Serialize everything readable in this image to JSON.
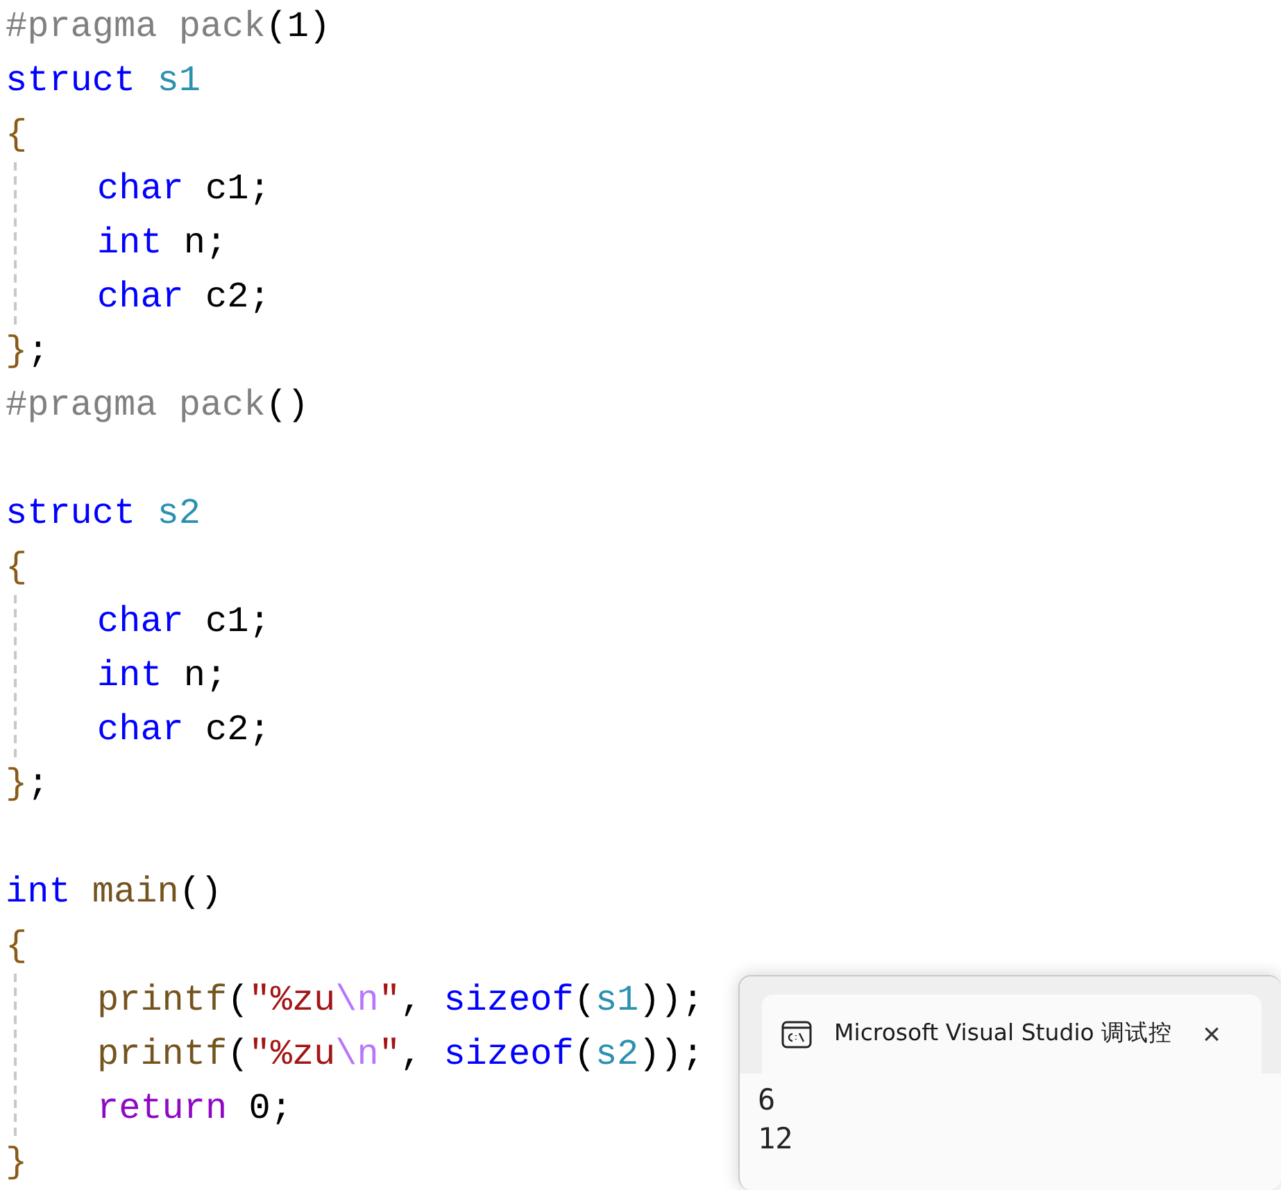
{
  "code_sections": [
    {
      "lines": [
        {
          "tokens": [
            {
              "text": "#pragma pack",
              "kind": "macro"
            },
            {
              "text": "(1)",
              "kind": "plain"
            }
          ]
        },
        {
          "tokens": [
            {
              "text": "struct",
              "kind": "keyword"
            },
            {
              "text": " s1",
              "kind": "type"
            }
          ]
        },
        {
          "tokens": [
            {
              "text": "{",
              "kind": "brace"
            }
          ],
          "children": [
            {
              "tokens": [
                {
                  "text": "char",
                  "kind": "keyword"
                },
                {
                  "text": " c1;",
                  "kind": "plain"
                }
              ]
            },
            {
              "tokens": [
                {
                  "text": "int",
                  "kind": "keyword"
                },
                {
                  "text": " n;",
                  "kind": "plain"
                }
              ]
            },
            {
              "tokens": [
                {
                  "text": "char",
                  "kind": "keyword"
                },
                {
                  "text": " c2;",
                  "kind": "plain"
                }
              ]
            }
          ]
        },
        {
          "tokens": [
            {
              "text": "}",
              "kind": "brace"
            },
            {
              "text": ";",
              "kind": "plain"
            }
          ]
        },
        {
          "tokens": [
            {
              "text": "#pragma pack",
              "kind": "macro"
            },
            {
              "text": "()",
              "kind": "plain"
            }
          ]
        }
      ]
    },
    {
      "lines": [
        {
          "tokens": [
            {
              "text": "struct",
              "kind": "keyword"
            },
            {
              "text": " s2",
              "kind": "type"
            }
          ]
        },
        {
          "tokens": [
            {
              "text": "{",
              "kind": "brace"
            }
          ],
          "children": [
            {
              "tokens": [
                {
                  "text": "char",
                  "kind": "keyword"
                },
                {
                  "text": " c1;",
                  "kind": "plain"
                }
              ]
            },
            {
              "tokens": [
                {
                  "text": "int",
                  "kind": "keyword"
                },
                {
                  "text": " n;",
                  "kind": "plain"
                }
              ]
            },
            {
              "tokens": [
                {
                  "text": "char",
                  "kind": "keyword"
                },
                {
                  "text": " c2;",
                  "kind": "plain"
                }
              ]
            }
          ]
        },
        {
          "tokens": [
            {
              "text": "}",
              "kind": "brace"
            },
            {
              "text": ";",
              "kind": "plain"
            }
          ]
        }
      ]
    },
    {
      "lines": [
        {
          "tokens": [
            {
              "text": "int",
              "kind": "keyword"
            },
            {
              "text": " main",
              "kind": "function"
            },
            {
              "text": "()",
              "kind": "plain"
            }
          ]
        },
        {
          "tokens": [
            {
              "text": "{",
              "kind": "brace"
            }
          ],
          "children": [
            {
              "tokens": [
                {
                  "text": "printf",
                  "kind": "function"
                },
                {
                  "text": "(",
                  "kind": "plain"
                },
                {
                  "text": "\"%zu",
                  "kind": "string"
                },
                {
                  "text": "\\n",
                  "kind": "escape"
                },
                {
                  "text": "\"",
                  "kind": "string"
                },
                {
                  "text": ", ",
                  "kind": "plain"
                },
                {
                  "text": "sizeof",
                  "kind": "keyword"
                },
                {
                  "text": "(",
                  "kind": "plain"
                },
                {
                  "text": "s1",
                  "kind": "type"
                },
                {
                  "text": "));",
                  "kind": "plain"
                }
              ]
            },
            {
              "tokens": [
                {
                  "text": "printf",
                  "kind": "function"
                },
                {
                  "text": "(",
                  "kind": "plain"
                },
                {
                  "text": "\"%zu",
                  "kind": "string"
                },
                {
                  "text": "\\n",
                  "kind": "escape"
                },
                {
                  "text": "\"",
                  "kind": "string"
                },
                {
                  "text": ", ",
                  "kind": "plain"
                },
                {
                  "text": "sizeof",
                  "kind": "keyword"
                },
                {
                  "text": "(",
                  "kind": "plain"
                },
                {
                  "text": "s2",
                  "kind": "type"
                },
                {
                  "text": "));",
                  "kind": "plain"
                }
              ]
            },
            {
              "tokens": [
                {
                  "text": "return",
                  "kind": "control"
                },
                {
                  "text": " 0;",
                  "kind": "plain"
                }
              ]
            }
          ]
        },
        {
          "tokens": [
            {
              "text": "}",
              "kind": "brace"
            }
          ]
        }
      ]
    }
  ],
  "console": {
    "title": "Microsoft Visual Studio 调试控",
    "close": "×",
    "output": [
      "6",
      "12"
    ]
  }
}
